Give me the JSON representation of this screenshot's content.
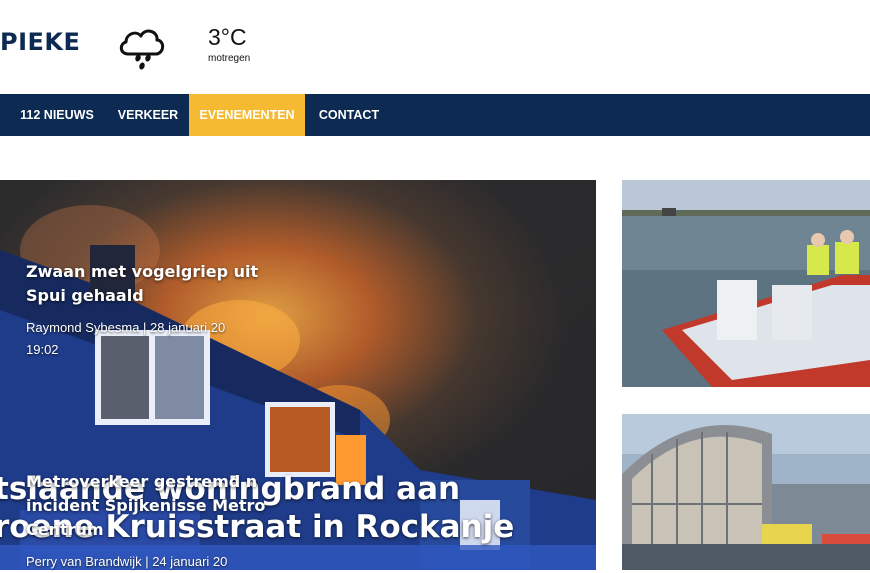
{
  "header": {
    "logo_text": "PIEKE",
    "weather": {
      "icon": "rain-cloud-icon",
      "temperature": "3°C",
      "condition": "motregen"
    }
  },
  "nav": {
    "items": [
      {
        "label": "112 NIEUWS"
      },
      {
        "label": "VERKEER"
      },
      {
        "label": "EVENEMENTEN",
        "active": true
      },
      {
        "label": "CONTACT"
      }
    ],
    "background": "#0c2a52",
    "active_color": "#f5b932"
  },
  "hero": {
    "title_line1": "tslaande woningbrand aan",
    "title_line2": "roene Kruisstraat in Rockanje"
  },
  "side_articles": [
    {
      "title_line1": "Zwaan met vogelgriep uit",
      "title_line2": "Spui gehaald",
      "meta_line1": "Raymond Sybesma | 28 januari 20",
      "meta_line2": "19:02"
    },
    {
      "title_line1": "Metroverkeer gestremd n",
      "title_line2": "incident Spijkenisse Metro",
      "title_line3": "Centrum",
      "meta_line1": "Perry van Brandwijk | 24 januari 20"
    }
  ]
}
